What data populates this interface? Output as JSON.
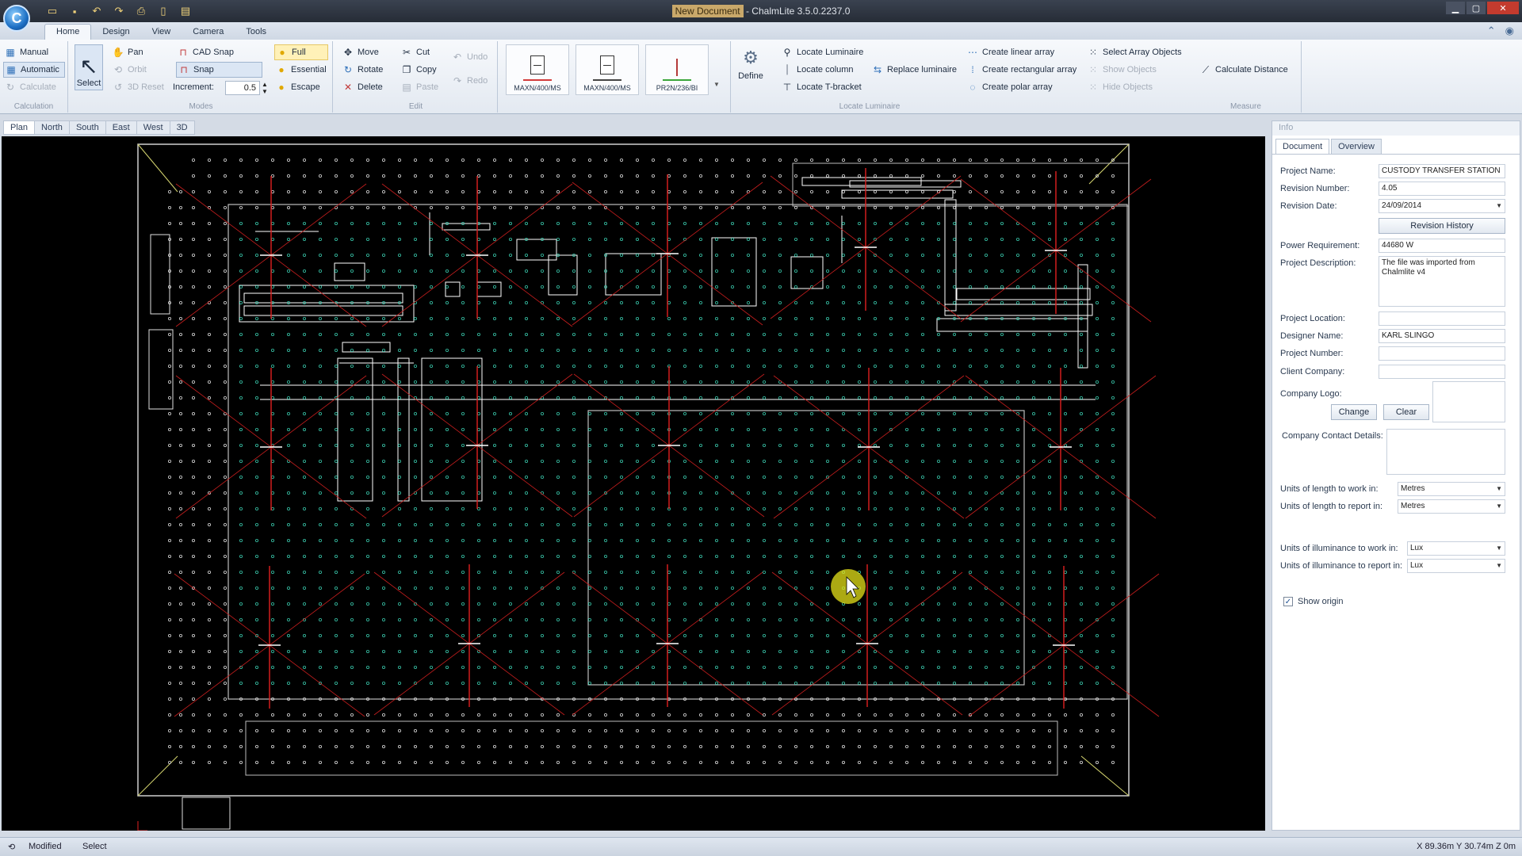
{
  "window": {
    "title_doc": "New Document",
    "title_app": " - ChalmLite 3.5.0.2237.0"
  },
  "ribbon_tabs": [
    "Home",
    "Design",
    "View",
    "Camera",
    "Tools"
  ],
  "ribbon": {
    "calculation": {
      "label": "Calculation",
      "manual": "Manual",
      "automatic": "Automatic",
      "calculate": "Calculate"
    },
    "modes": {
      "label": "Modes",
      "select": "Select",
      "pan": "Pan",
      "orbit": "Orbit",
      "reset_3d": "3D Reset",
      "cad_snap": "CAD Snap",
      "snap": "Snap",
      "increment_label": "Increment:",
      "increment_value": "0.5",
      "full": "Full",
      "essential": "Essential",
      "escape": "Escape"
    },
    "edit": {
      "label": "Edit",
      "move": "Move",
      "rotate": "Rotate",
      "delete": "Delete",
      "cut": "Cut",
      "copy": "Copy",
      "paste": "Paste",
      "undo": "Undo",
      "redo": "Redo"
    },
    "luminaires": [
      {
        "label": "MAXN/400/MS",
        "color": "#d23b3b"
      },
      {
        "label": "MAXN/400/MS",
        "color": "#444444"
      },
      {
        "label": "PR2N/236/BI",
        "color": "#3aa63a"
      }
    ],
    "define": "Define",
    "locate": {
      "label": "Locate Luminaire",
      "locate_luminaire": "Locate Luminaire",
      "locate_column": "Locate column",
      "locate_tbracket": "Locate T-bracket",
      "replace_luminaire": "Replace luminaire",
      "linear_array": "Create linear array",
      "rect_array": "Create rectangular array",
      "polar_array": "Create polar array",
      "select_array": "Select Array Objects",
      "show_objects": "Show Objects",
      "hide_objects": "Hide Objects"
    },
    "measure": {
      "label": "Measure",
      "calc_distance": "Calculate Distance"
    }
  },
  "view_tabs": [
    "Plan",
    "North",
    "South",
    "East",
    "West",
    "3D"
  ],
  "info": {
    "header": "Info",
    "tabs": [
      "Document",
      "Overview"
    ],
    "project_name_label": "Project Name:",
    "project_name": "CUSTODY TRANSFER STATION",
    "revision_number_label": "Revision Number:",
    "revision_number": "4.05",
    "revision_date_label": "Revision Date:",
    "revision_date": "24/09/2014",
    "revision_history": "Revision History",
    "power_label": "Power Requirement:",
    "power": "44680 W",
    "description_label": "Project Description:",
    "description": "The file was imported from Chalmlite v4",
    "location_label": "Project Location:",
    "designer_label": "Designer Name:",
    "designer": "KARL SLINGO",
    "project_number_label": "Project Number:",
    "client_label": "Client Company:",
    "logo_label": "Company Logo:",
    "change": "Change",
    "clear": "Clear",
    "contact_label": "Company Contact Details:",
    "units_length_work_label": "Units of length to work in:",
    "units_length_work": "Metres",
    "units_length_report_label": "Units of length to report in:",
    "units_length_report": "Metres",
    "units_illum_work_label": "Units of illuminance to work in:",
    "units_illum_work": "Lux",
    "units_illum_report_label": "Units of illuminance to report in:",
    "units_illum_report": "Lux",
    "show_origin": "Show origin"
  },
  "status": {
    "modified": "Modified",
    "mode": "Select",
    "coords": "X 89.36m Y 30.74m Z 0m"
  }
}
